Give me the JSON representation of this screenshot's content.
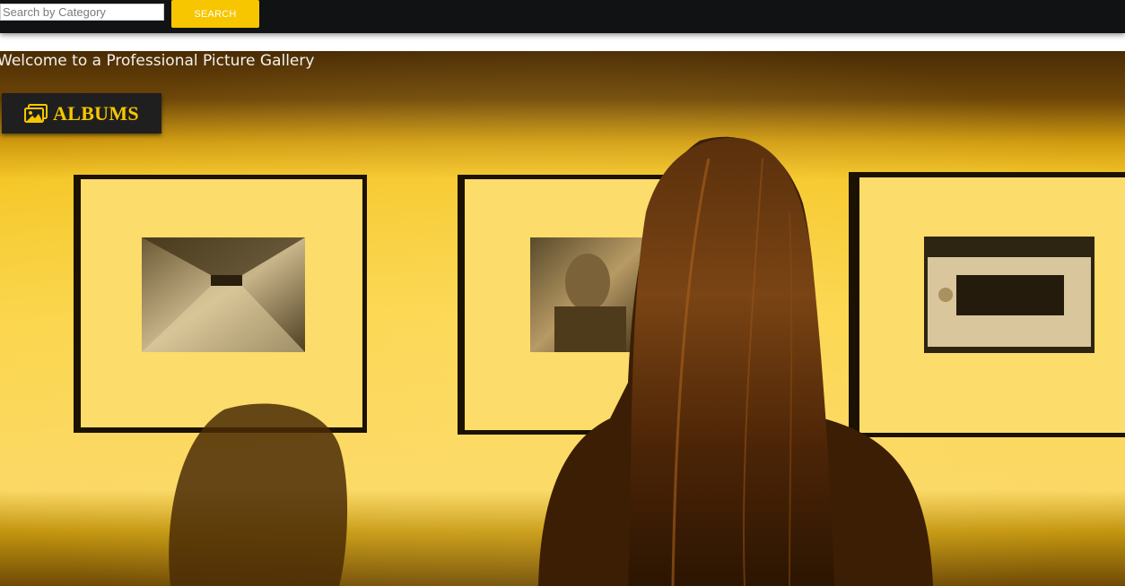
{
  "header": {
    "search": {
      "placeholder": "Search by Category",
      "value": ""
    },
    "search_button_label": "SEARCH"
  },
  "hero": {
    "welcome_text": "Welcome to a Professional Picture Gallery",
    "albums_button_label": "ALBUMS",
    "albums_icon": "images-icon"
  },
  "colors": {
    "accent": "#f7c600",
    "topbar": "#111214",
    "button_dark": "#1f1f1f"
  }
}
